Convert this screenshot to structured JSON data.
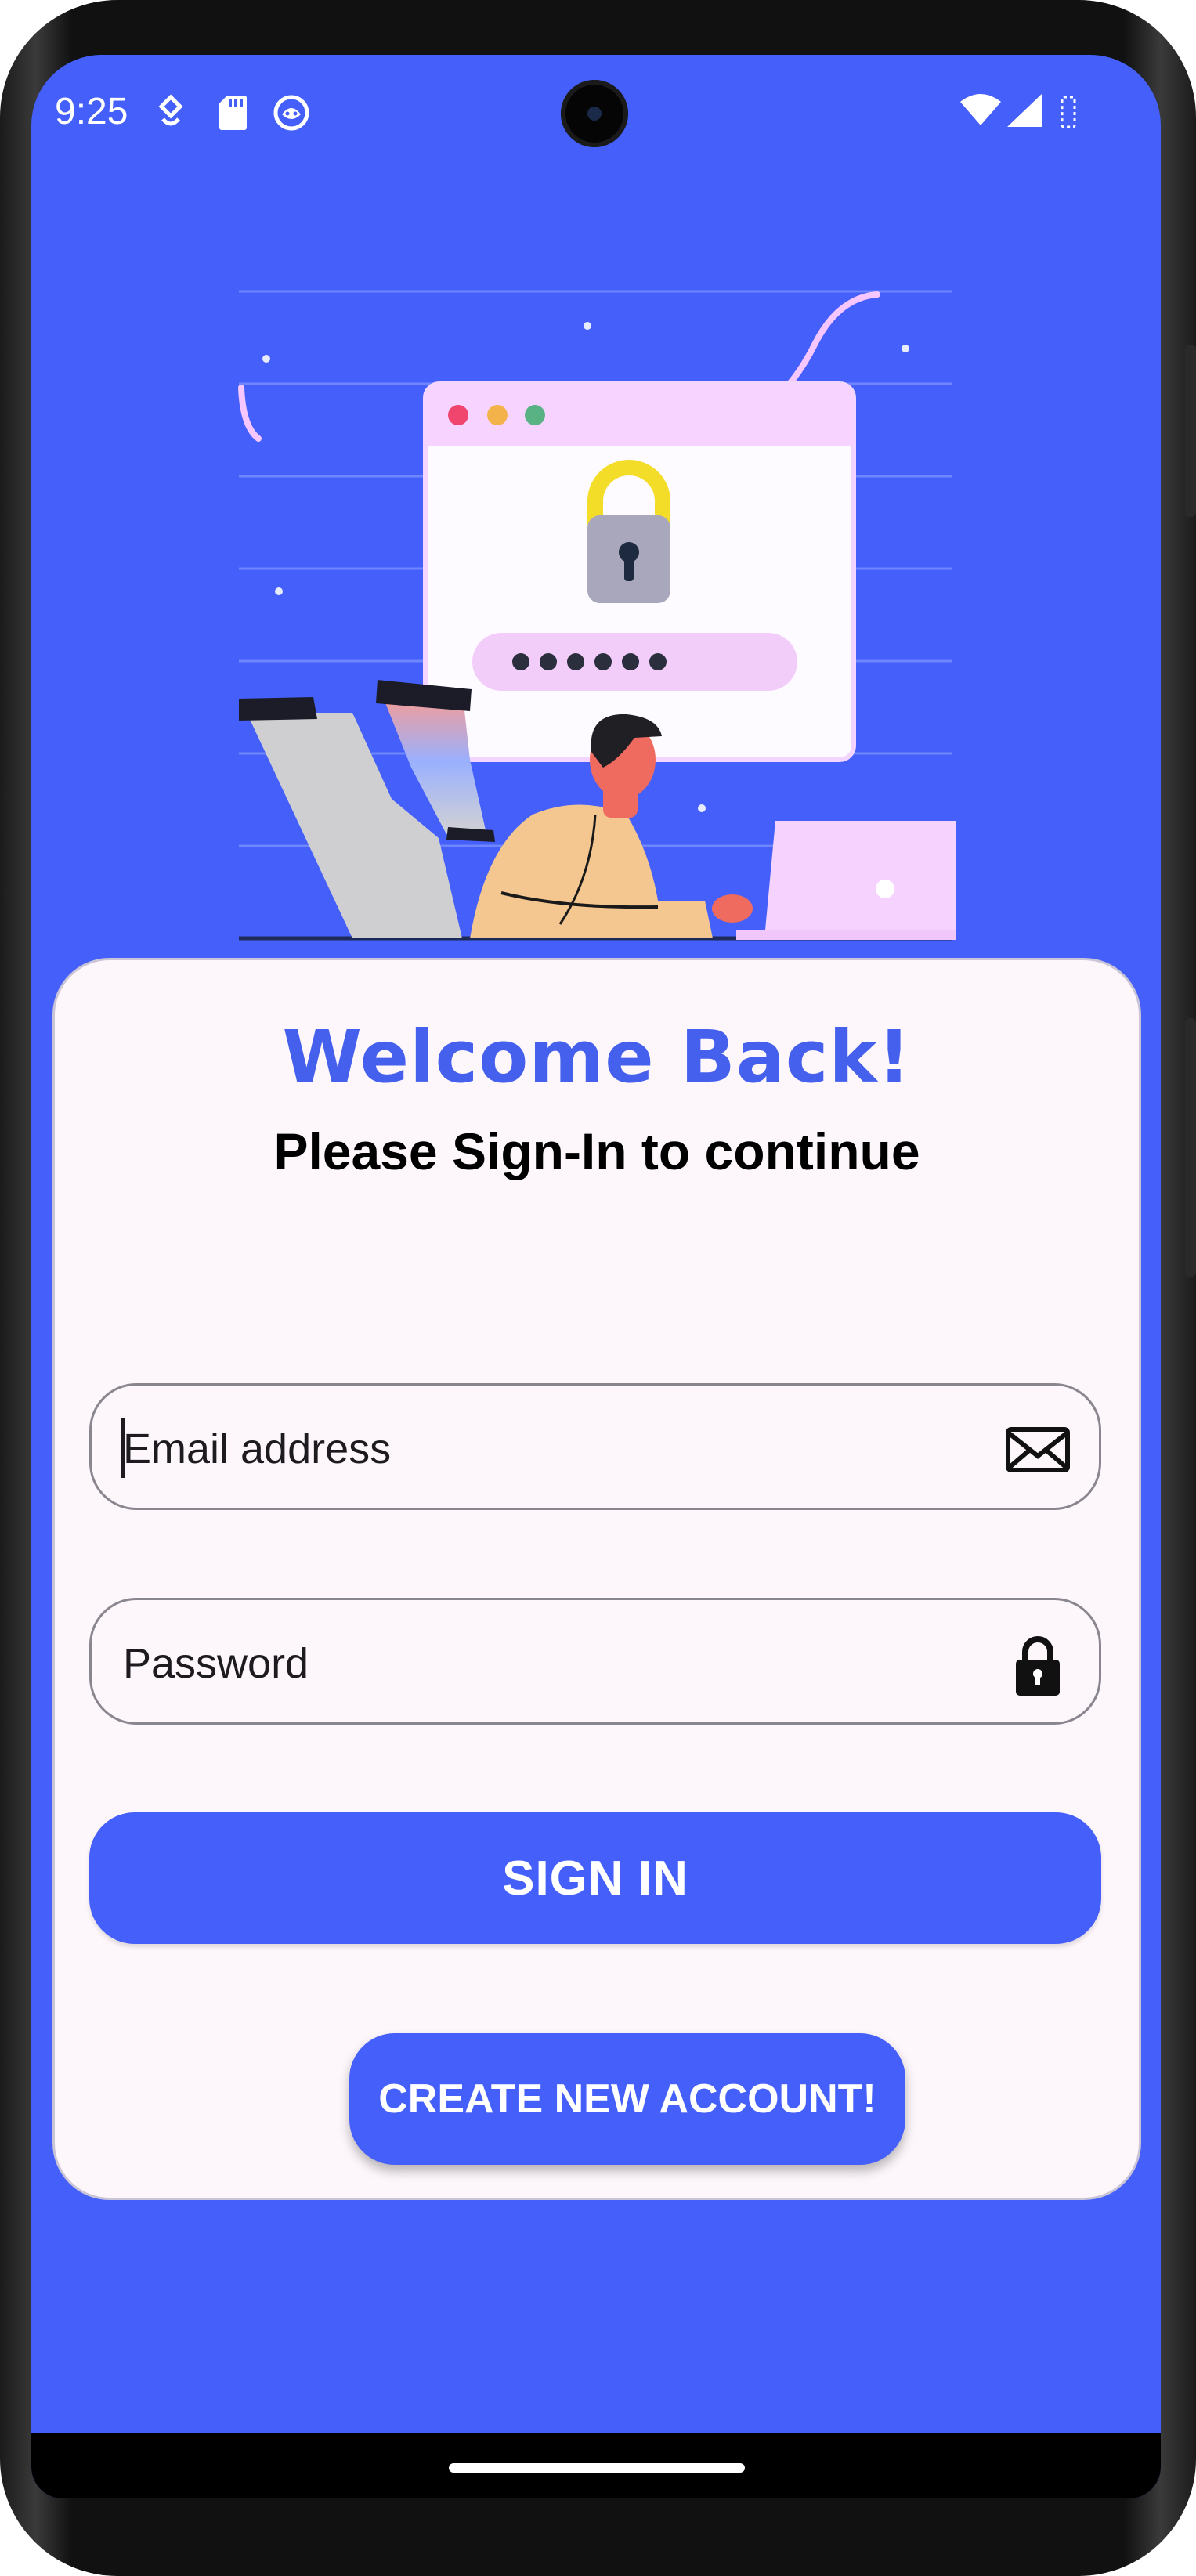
{
  "status_bar": {
    "time": "9:25",
    "icons": [
      "wellbeing-icon",
      "sd-card-icon",
      "app-notification-icon",
      "wifi-icon",
      "signal-icon",
      "battery-icon"
    ]
  },
  "illustration": {
    "description_icon": "login-security-illustration",
    "password_dots": "••••••"
  },
  "login_card": {
    "title": "Welcome Back!",
    "subtitle": "Please Sign-In to continue",
    "email": {
      "placeholder": "Email address",
      "value": "",
      "icon": "envelope-icon"
    },
    "password": {
      "placeholder": "Password",
      "value": "",
      "icon": "lock-icon"
    },
    "sign_in_label": "SIGN IN",
    "create_account_label": "CREATE NEW ACCOUNT!"
  },
  "colors": {
    "background": "#4560fa",
    "card": "#fdf7fb",
    "accent_title": "#4560ec",
    "button": "#4560fa"
  }
}
